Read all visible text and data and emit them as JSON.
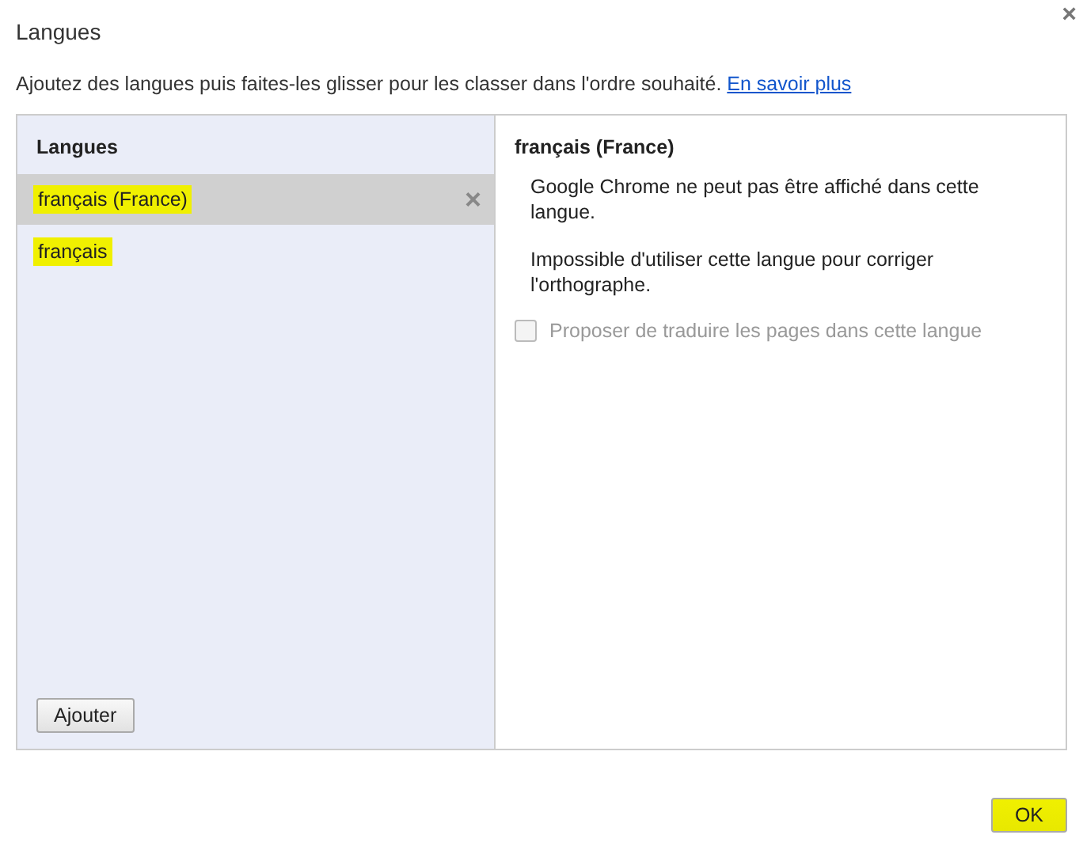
{
  "window": {
    "title": "Langues",
    "close": "×"
  },
  "description": {
    "text": "Ajoutez des langues puis faites-les glisser pour les classer dans l'ordre souhaité.",
    "link": "En savoir plus"
  },
  "languages": {
    "heading": "Langues",
    "items": [
      {
        "label": "français (France)",
        "selected": true,
        "highlighted": true,
        "remove": "×"
      },
      {
        "label": "français",
        "selected": false,
        "highlighted": true
      }
    ],
    "add_button": "Ajouter"
  },
  "details": {
    "title": "français (France)",
    "messages": [
      "Google Chrome ne peut pas être affiché dans cette langue.",
      "Impossible d'utiliser cette langue pour corriger l'orthographe."
    ],
    "translate": {
      "label": "Proposer de traduire les pages dans cette langue",
      "checked": false,
      "disabled": true
    }
  },
  "ok_button": {
    "label": "OK",
    "highlighted": true
  }
}
